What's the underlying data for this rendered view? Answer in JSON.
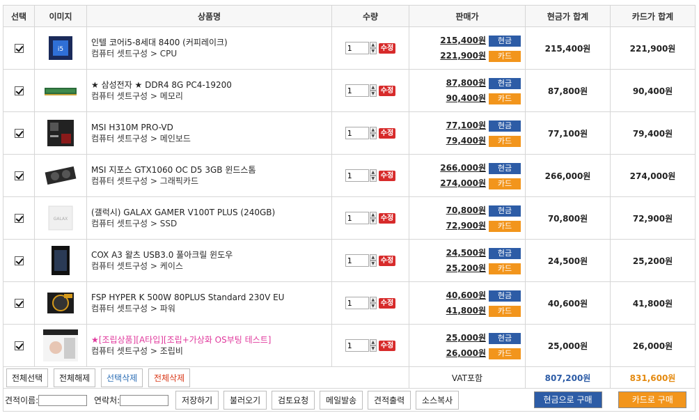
{
  "headers": {
    "select": "선택",
    "image": "이미지",
    "name": "상품명",
    "qty": "수량",
    "price": "판매가",
    "cash_total": "현금가 합계",
    "card_total": "카드가 합계"
  },
  "labels": {
    "modify": "수정",
    "cash_tag": "현금",
    "card_tag": "카드"
  },
  "items": [
    {
      "name": "인텔 코어i5-8세대 8400 (커피레이크)",
      "category": "컴퓨터 셋트구성 > CPU",
      "qty": "1",
      "cash_price": "215,400원",
      "card_price": "221,900원",
      "cash_sum": "215,400원",
      "card_sum": "221,900원",
      "checked": true,
      "thumb": "cpu"
    },
    {
      "name": "★ 삼성전자 ★ DDR4 8G PC4-19200",
      "category": "컴퓨터 셋트구성 > 메모리",
      "qty": "1",
      "cash_price": "87,800원",
      "card_price": "90,400원",
      "cash_sum": "87,800원",
      "card_sum": "90,400원",
      "checked": true,
      "thumb": "ram"
    },
    {
      "name": "MSI H310M PRO-VD",
      "category": "컴퓨터 셋트구성 > 메인보드",
      "qty": "1",
      "cash_price": "77,100원",
      "card_price": "79,400원",
      "cash_sum": "77,100원",
      "card_sum": "79,400원",
      "checked": true,
      "thumb": "board"
    },
    {
      "name": "MSI 지포스 GTX1060 OC D5 3GB 윈드스톰",
      "category": "컴퓨터 셋트구성 > 그래픽카드",
      "qty": "1",
      "cash_price": "266,000원",
      "card_price": "274,000원",
      "cash_sum": "266,000원",
      "card_sum": "274,000원",
      "checked": true,
      "thumb": "gpu"
    },
    {
      "name": "(갤럭시) GALAX GAMER V100T PLUS (240GB)",
      "category": "컴퓨터 셋트구성 > SSD",
      "qty": "1",
      "cash_price": "70,800원",
      "card_price": "72,900원",
      "cash_sum": "70,800원",
      "card_sum": "72,900원",
      "checked": true,
      "thumb": "ssd"
    },
    {
      "name": "COX A3 왈츠 USB3.0 풀아크릴 윈도우",
      "category": "컴퓨터 셋트구성 > 케이스",
      "qty": "1",
      "cash_price": "24,500원",
      "card_price": "25,200원",
      "cash_sum": "24,500원",
      "card_sum": "25,200원",
      "checked": true,
      "thumb": "case"
    },
    {
      "name": "FSP HYPER K 500W 80PLUS Standard 230V EU",
      "category": "컴퓨터 셋트구성 > 파워",
      "qty": "1",
      "cash_price": "40,600원",
      "card_price": "41,800원",
      "cash_sum": "40,600원",
      "card_sum": "41,800원",
      "checked": true,
      "thumb": "psu"
    },
    {
      "name": "★[조립상품][A타입][조립+가상화 OS부팅 테스트]",
      "category": "컴퓨터 셋트구성 > 조립비",
      "qty": "1",
      "cash_price": "25,000원",
      "card_price": "26,000원",
      "cash_sum": "25,000원",
      "card_sum": "26,000원",
      "checked": true,
      "thumb": "assembly",
      "highlight": true
    }
  ],
  "footer": {
    "select_all": "전체선택",
    "deselect_all": "전체해제",
    "delete_selected": "선택삭제",
    "delete_all": "전체삭제",
    "vat": "VAT포함",
    "total_cash": "807,200원",
    "total_card": "831,600원",
    "quote_name_label": "견적이름:",
    "contact_label": "연락처:",
    "quote_name_value": "",
    "contact_value": "",
    "save": "저장하기",
    "load": "불러오기",
    "review": "검토요청",
    "email": "메일발송",
    "print": "견적출력",
    "source_copy": "소스복사",
    "buy_cash": "현금으로 구매",
    "buy_card": "카드로 구매"
  },
  "colors": {
    "cash": "#2d5ca6",
    "card": "#f2951c",
    "modify": "#d72b2b",
    "pink": "#e0389c"
  }
}
